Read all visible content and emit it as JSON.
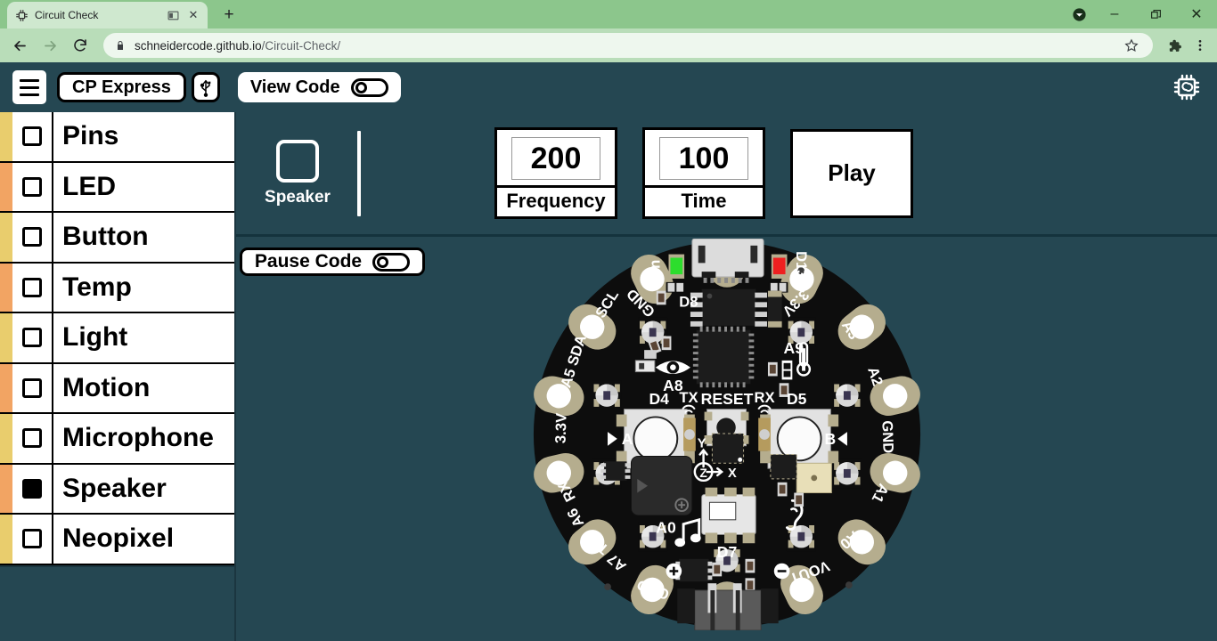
{
  "browser": {
    "tab": {
      "title": "Circuit Check",
      "favicon_icon": "chip-icon",
      "media_icon": "cast-icon",
      "close_icon": "close-icon"
    },
    "new_tab_label": "+",
    "window_controls": {
      "minimize": "–",
      "maximize": "❐",
      "close": "✕",
      "profile_icon": "profile-icon"
    },
    "nav": {
      "back_icon": "arrow-left-icon",
      "forward_icon": "arrow-right-icon",
      "reload_icon": "reload-icon"
    },
    "omnibox": {
      "lock_icon": "lock-icon",
      "url_host": "schneidercode.github.io",
      "url_path": "/Circuit-Check/",
      "star_icon": "star-icon"
    },
    "extensions_icon": "puzzle-icon",
    "menu_icon": "kebab-menu-icon"
  },
  "appbar": {
    "menu_icon": "hamburger-icon",
    "board_label": "CP Express",
    "usb_icon": "usb-icon",
    "view_code_label": "View Code",
    "view_code_on": false,
    "settings_icon": "chip-gear-icon"
  },
  "sidebar": {
    "items": [
      {
        "label": "Pins",
        "checked": false,
        "strip": "#e9cd6d"
      },
      {
        "label": "LED",
        "checked": false,
        "strip": "#f2a463"
      },
      {
        "label": "Button",
        "checked": false,
        "strip": "#e9cd6d"
      },
      {
        "label": "Temp",
        "checked": false,
        "strip": "#f2a463"
      },
      {
        "label": "Light",
        "checked": false,
        "strip": "#e9cd6d"
      },
      {
        "label": "Motion",
        "checked": false,
        "strip": "#f2a463"
      },
      {
        "label": "Microphone",
        "checked": false,
        "strip": "#e9cd6d"
      },
      {
        "label": "Speaker",
        "checked": true,
        "strip": "#f2a463"
      },
      {
        "label": "Neopixel",
        "checked": false,
        "strip": "#e9cd6d"
      }
    ]
  },
  "speaker_panel": {
    "title": "Speaker",
    "frequency": {
      "value": "200",
      "caption": "Frequency"
    },
    "time": {
      "value": "100",
      "caption": "Time"
    },
    "play_label": "Play"
  },
  "pause": {
    "label": "Pause Code",
    "on": false
  },
  "board": {
    "name": "Circuit Playground Express",
    "pad_labels_outer": [
      "GND",
      "3.3V",
      "A3",
      "A2",
      "GND",
      "A1",
      "A0",
      "VOUT",
      "GND",
      "A7",
      "A6",
      "A5",
      "A4",
      "3.3V",
      "SCL",
      "SDA",
      "TX",
      "RX"
    ],
    "silkscreen": {
      "power_led": "On",
      "d13_led": "D13",
      "left_button": "D4",
      "left_button_letter": "A",
      "right_button": "D5",
      "right_button_letter": "B",
      "reset": "RESET",
      "tx": "TX",
      "rx": "RX",
      "light_sensor": "A8",
      "temp_sensor": "A9",
      "speaker": "A0",
      "ir": "D7",
      "d8": "D8",
      "axes": [
        "X",
        "Y",
        "Z"
      ],
      "battery_plus": "+",
      "battery_minus": "−",
      "pads_left": [
        "SCL",
        "A4",
        "SDA",
        "A5",
        "3.3V",
        "RX",
        "A6",
        "TX",
        "A7",
        "GND"
      ],
      "pads_right": [
        "3.3V",
        "A3",
        "A2",
        "GND",
        "A1",
        "A0",
        "VOUT"
      ],
      "icons": [
        "eye-icon",
        "thermometer-icon",
        "music-note-icon",
        "ear-icon"
      ]
    },
    "colors": {
      "pcb": "#0d0d0d",
      "pad": "#b5ad8e",
      "led_on_green": "#2ddd2d",
      "led_d13_red": "#ee2020",
      "neopixel": "#d8d8d8",
      "button": "#e0e0e0"
    }
  },
  "theme": {
    "panel_bg": "#254752",
    "accent_white": "#ffffff",
    "outline": "#000000"
  }
}
